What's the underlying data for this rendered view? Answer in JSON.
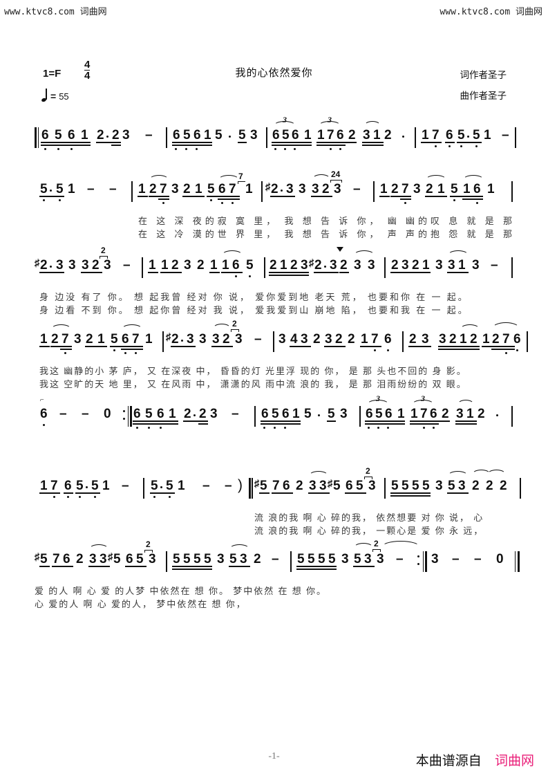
{
  "watermark": {
    "left": "www.ktvc8.com  词曲网",
    "right": "www.ktvc8.com  词曲网"
  },
  "header": {
    "key_label": "1=F",
    "time_numerator": "4",
    "time_denominator": "4",
    "tempo_note_icon": "quarter-note-icon",
    "tempo_equals": "=",
    "tempo_bpm": "55",
    "title": "我的心依然爱你",
    "lyricist": "词作者圣子",
    "composer": "曲作者圣子"
  },
  "notation": {
    "style": "jianpu-numbered-notation",
    "key": "F",
    "time_signature": "4/4",
    "tempo": 55
  },
  "systems": [
    {
      "id": "system-1",
      "measures": [
        {
          "notes": "6 5 6 1 2· 2 3  –"
        },
        {
          "notes": "6 5 6 1 5 · 5 3"
        },
        {
          "notes": "6 5 6 1 (3)  1 7 6 2 (3)  3 1 2 ·"
        },
        {
          "notes": "1 7 6 5· 5 1  –"
        }
      ],
      "lyrics_line1": "",
      "lyrics_line2": ""
    },
    {
      "id": "system-2",
      "measures": [
        {
          "notes": "5· 5 1 – –"
        },
        {
          "notes": "1 2 7 3 2 1 5 6 7 [7] 1"
        },
        {
          "notes": "#2· 3 3 3 2 [24] 3  –"
        },
        {
          "notes": "1 2 7 3 2 1 5 1 6 1"
        }
      ],
      "lyrics_line1": "在 这   深 夜的寂 寞  里，    我  想 告 诉  你，      幽 幽的叹 息  就 是  那",
      "lyrics_line2": "在 这   冷 漠的世 界  里，    我  想 告 诉  你，      声 声的抱 怨  就 是  那"
    },
    {
      "id": "system-3",
      "measures": [
        {
          "notes": "#2· 3 3 3 2 [2] 3  –"
        },
        {
          "notes": "1 1 2 3 2 1 1 6 5"
        },
        {
          "notes": "2 1 2 3 #2· 3 2 3 3"
        },
        {
          "notes": "2 3 2 1 3 3 1 3  –"
        }
      ],
      "lyrics_line1": "身 边没 有了 你。   想 起我曾 经对 你  说，   爱你爱到地  老天  荒，    也要和你 在 一   起。",
      "lyrics_line2": "身 边看 不到 你。   想 起你曾 经对 我  说，   爱我爱到山  崩地  陷，    也要和我 在 一   起。"
    },
    {
      "id": "system-4",
      "measures": [
        {
          "notes": "1 2 7 3 2 1 5 6 7 1"
        },
        {
          "notes": "#2· 3 3 3 2 [2] 3  –"
        },
        {
          "notes": "3 4 3 2 3 2 2 1 7 6"
        },
        {
          "notes": "2 3  3 2 1 2 1 2 7 6"
        }
      ],
      "lyrics_line1": "我这  幽静的小 茅  庐，   又  在深夜  中，     昏昏的灯 光里浮 现的  你，   是 那  头也不回的 身  影。",
      "lyrics_line2": "我这  空旷的天 地  里，   又  在风雨  中，     潇潇的风 雨中流 浪的  我，   是 那  泪雨纷纷的 双  眼。"
    },
    {
      "id": "system-5",
      "measures": [
        {
          "notes": "6 – – 0"
        },
        {
          "notes": "6 5 6 1 2· 2 3  –"
        },
        {
          "notes": "6 5 6 1 5 · 5 3"
        },
        {
          "notes": "6 5 6 1 (3) 1 7 6 2 (3) 3 1 2 ·"
        }
      ],
      "repeat_start_after_measure": 1,
      "lyrics_line1": "",
      "lyrics_line2": ""
    },
    {
      "id": "system-6",
      "measures": [
        {
          "notes": "1 7 6 5· 5 1  –"
        },
        {
          "notes": "5· 5 1  –  – )"
        },
        {
          "notes": "#5 7 6 2 3 3 #5 6 5 [2] 3"
        },
        {
          "notes": "5 5 5 5 3 5 3 2 2 2"
        }
      ],
      "lyrics_line1": "流 浪的我 啊  心 碎的我，   依然想要 对 你  说，  心",
      "lyrics_line2": "流 浪的我 啊  心 碎的我，   一颗心是 爱 你  永 远，"
    },
    {
      "id": "system-7",
      "measures": [
        {
          "notes": "#5 7 6 2 3 3 #5 6 5 [2] 3"
        },
        {
          "notes": "5 5 5 5 3 5 3 2  –"
        },
        {
          "notes": "5 5 5 5 3 5 3 [2] 3  –"
        },
        {
          "notes": "3 – – 0"
        }
      ],
      "lyrics_line1": "爱 的人 啊  心 爱 的人梦   中依然在 想  你。      梦中依然 在 想  你。",
      "lyrics_line2": "心 爱的人 啊  心 爱的人，   梦中依然在 想  你，"
    }
  ],
  "footer": {
    "page_number": "-1-",
    "source_prefix": "本曲谱源自",
    "source_site": "词曲网",
    "source_site_color": "#ea1e78"
  }
}
